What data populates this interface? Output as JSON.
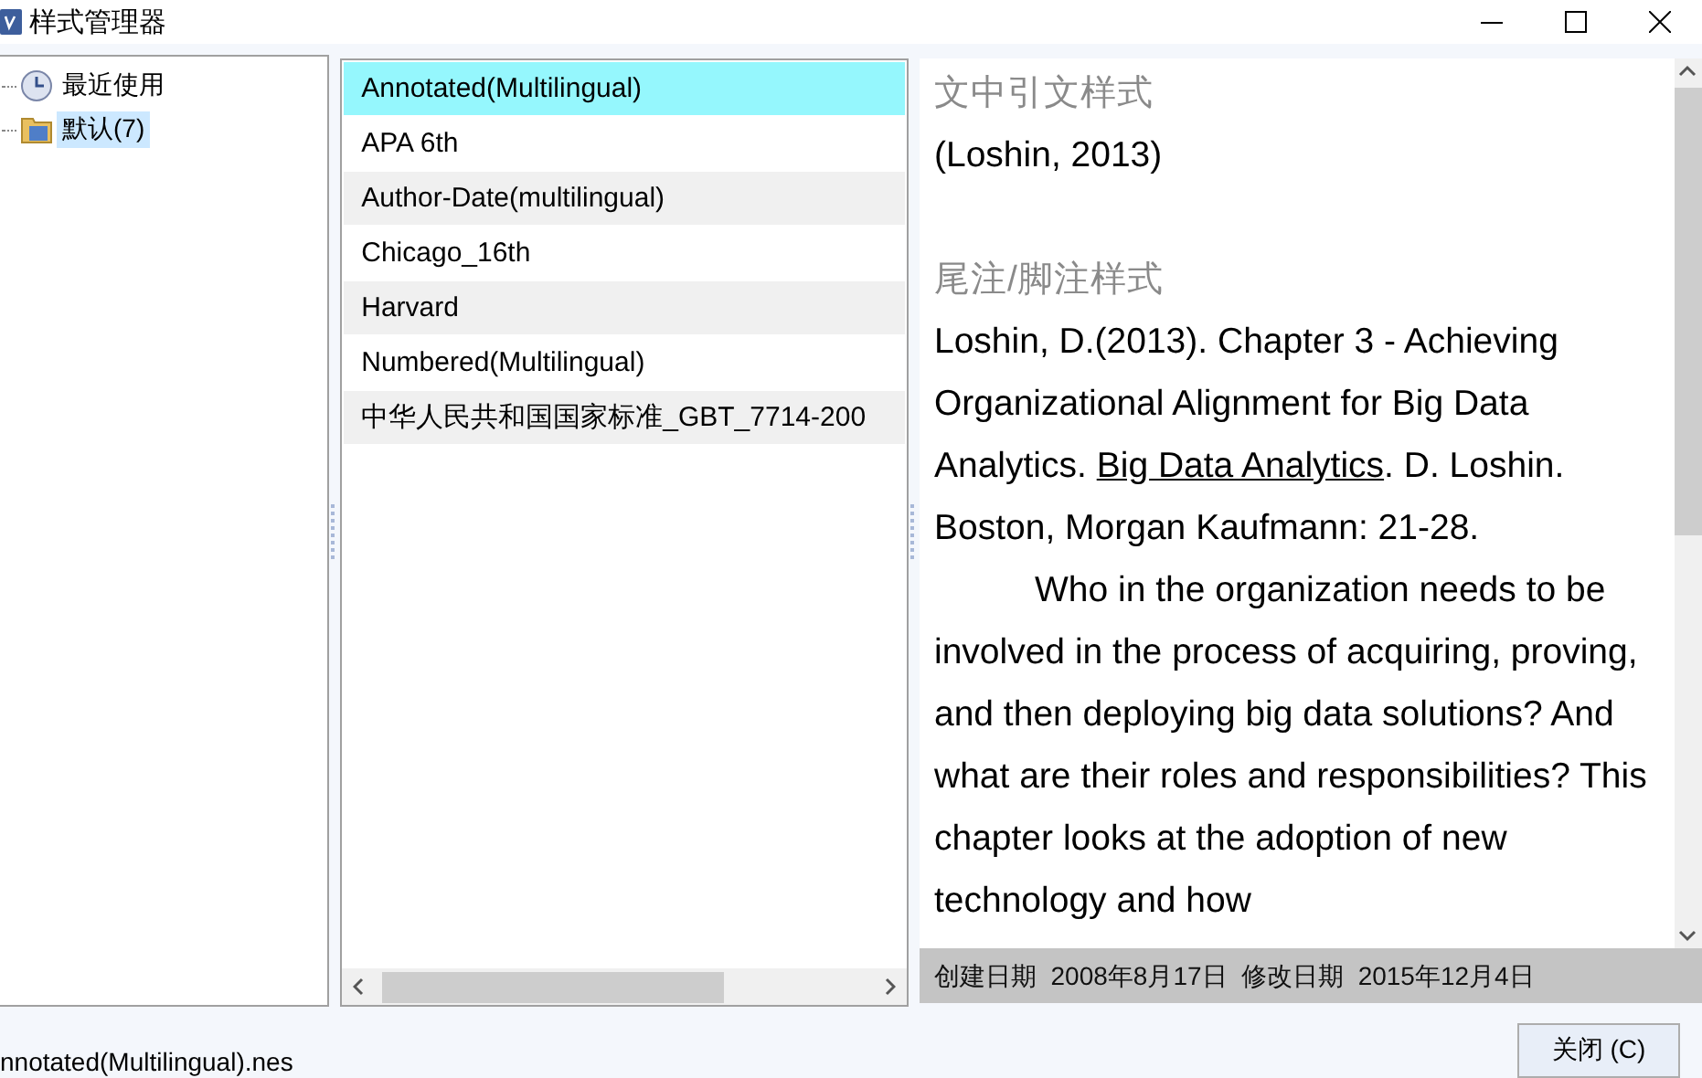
{
  "window": {
    "title": "样式管理器"
  },
  "tree": {
    "items": [
      {
        "label": "最近使用",
        "kind": "recent",
        "selected": false
      },
      {
        "label": "默认(7)",
        "kind": "folder",
        "selected": true
      }
    ]
  },
  "styles": {
    "items": [
      {
        "label": "Annotated(Multilingual)",
        "selected": true
      },
      {
        "label": "APA 6th",
        "selected": false
      },
      {
        "label": "Author-Date(multilingual)",
        "selected": false
      },
      {
        "label": "Chicago_16th",
        "selected": false
      },
      {
        "label": "Harvard",
        "selected": false
      },
      {
        "label": "Numbered(Multilingual)",
        "selected": false
      },
      {
        "label": "中华人民共和国国家标准_GBT_7714-200",
        "selected": false
      }
    ]
  },
  "preview": {
    "in_text_heading": "文中引文样式",
    "in_text": "(Loshin, 2013)",
    "note_heading": "尾注/脚注样式",
    "reference": [
      {
        "text": "Loshin, D.(2013). Chapter 3 - Achieving Organizational Alignment for Big Data Analytics. ",
        "underlined": false
      },
      {
        "text": "Big Data Analytics",
        "underlined": true
      },
      {
        "text": ". D. Loshin. Boston, Morgan Kaufmann: 21-28.",
        "underlined": false
      }
    ],
    "abstract": "Who in the organization needs to be involved in the process of acquiring, proving, and then deploying big data solutions? And what are their roles and responsibilities? This chapter looks at the adoption of new technology and how",
    "dates": "创建日期  2008年8月17日  修改日期  2015年12月4日"
  },
  "status": {
    "file": "nnotated(Multilingual).nes"
  },
  "buttons": [
    {
      "label": "关闭 (C)"
    }
  ]
}
